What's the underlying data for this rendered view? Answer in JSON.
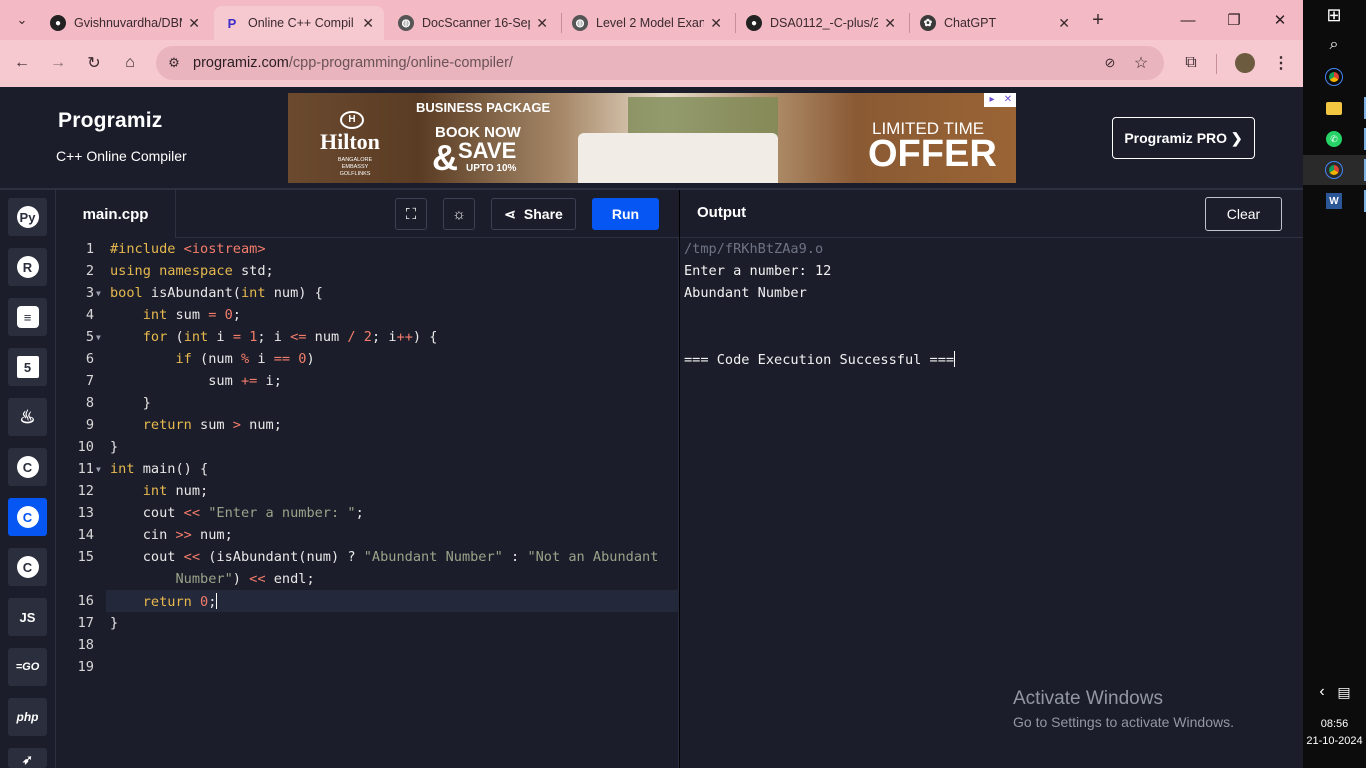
{
  "browser": {
    "tabs": [
      {
        "title": "Gvishnuvardha/DBM",
        "icon": "github-icon"
      },
      {
        "title": "Online C++ Compil",
        "icon": "programiz-icon",
        "active": true
      },
      {
        "title": "DocScanner 16-Sep",
        "icon": "globe-icon"
      },
      {
        "title": "Level 2 Model Exan",
        "icon": "globe-icon"
      },
      {
        "title": "DSA0112_-C-plus/2",
        "icon": "github-icon"
      },
      {
        "title": "ChatGPT",
        "icon": "chatgpt-icon"
      }
    ],
    "url_host": "programiz.com",
    "url_path": "/cpp-programming/online-compiler/"
  },
  "header": {
    "logo": "Programiz",
    "subtitle": "C++ Online Compiler",
    "pro_button": "Programiz PRO ❯"
  },
  "ad": {
    "brand": "Hilton",
    "brand_sub": "BANGALORE EMBASSY GOLFLINKS",
    "package": "BUSINESS PACKAGE",
    "book_now": "BOOK NOW",
    "save": "SAVE",
    "upto": "UPTO 10%",
    "limited": "LIMITED TIME",
    "offer": "OFFER"
  },
  "editor": {
    "filename": "main.cpp",
    "share_label": "Share",
    "run_label": "Run"
  },
  "output": {
    "label": "Output",
    "clear_label": "Clear",
    "lines": [
      "/tmp/fRKhBtZAa9.o",
      "Enter a number: 12",
      "Abundant Number",
      "",
      "",
      "=== Code Execution Successful ==="
    ]
  },
  "watermark": {
    "title": "Activate Windows",
    "subtitle": "Go to Settings to activate Windows."
  },
  "system": {
    "time": "08:56",
    "date": "21-10-2024"
  },
  "line_numbers": [
    "1",
    "2",
    "3",
    "4",
    "5",
    "6",
    "7",
    "8",
    "9",
    "10",
    "11",
    "12",
    "13",
    "14",
    "15",
    "16",
    "17",
    "18",
    "19"
  ],
  "sidebar_languages": [
    "python",
    "r",
    "sql",
    "html5",
    "java",
    "c",
    "cpp",
    "csharp",
    "js",
    "go",
    "php",
    "swift"
  ]
}
